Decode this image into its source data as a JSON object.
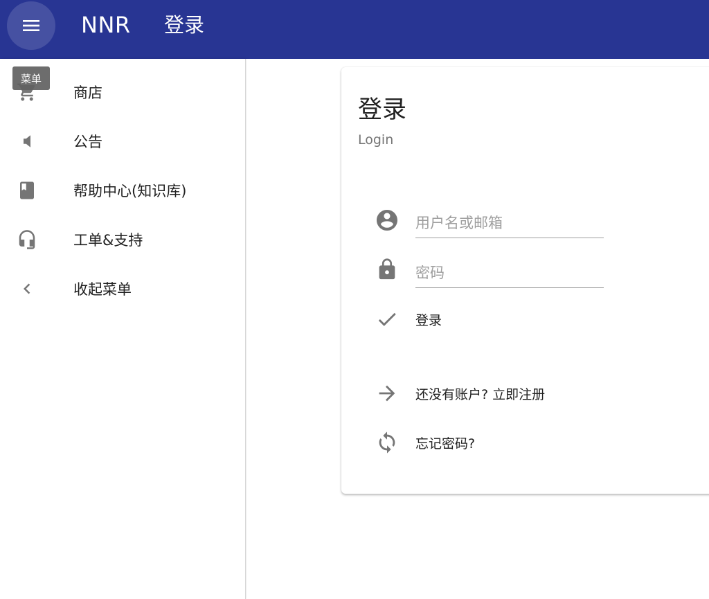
{
  "appbar": {
    "app_title": "NNR",
    "page_title": "登录",
    "menu_tooltip": "菜单",
    "color": "#283593"
  },
  "sidebar": {
    "items": [
      {
        "label": "商店",
        "icon": "cart-icon"
      },
      {
        "label": "公告",
        "icon": "speaker-icon"
      },
      {
        "label": "帮助中心(知识库)",
        "icon": "book-icon"
      },
      {
        "label": "工单&支持",
        "icon": "headset-icon"
      },
      {
        "label": "收起菜单",
        "icon": "chevron-left-icon"
      }
    ]
  },
  "login": {
    "title": "登录",
    "subtitle": "Login",
    "username_placeholder": "用户名或邮箱",
    "password_placeholder": "密码",
    "submit_label": "登录",
    "register_label": "还没有账户? 立即注册",
    "forgot_label": "忘记密码?"
  }
}
